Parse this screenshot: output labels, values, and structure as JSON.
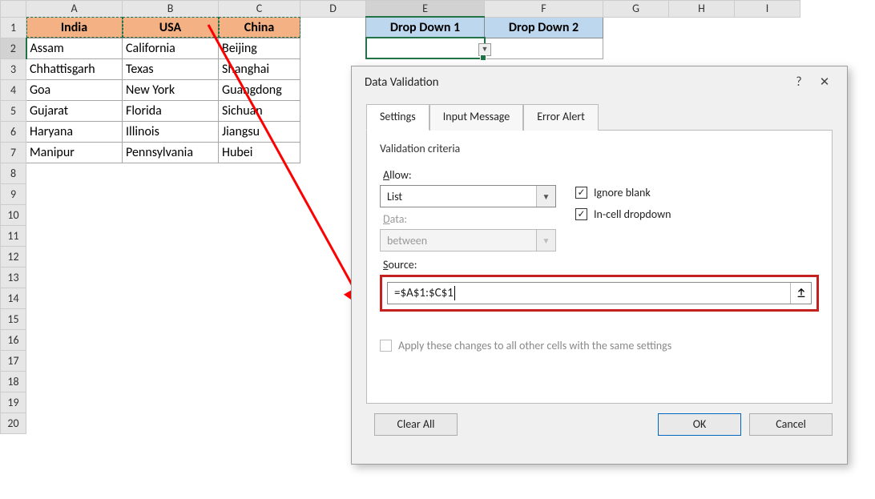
{
  "columns": [
    "A",
    "B",
    "C",
    "D",
    "E",
    "F",
    "G",
    "H",
    "I"
  ],
  "rows": [
    "1",
    "2",
    "3",
    "4",
    "5",
    "6",
    "7",
    "8",
    "9",
    "10",
    "11",
    "12",
    "13",
    "14",
    "15",
    "16",
    "17",
    "18",
    "19",
    "20"
  ],
  "sheet": {
    "headers": [
      "India",
      "USA",
      "China"
    ],
    "dropdown_headers": [
      "Drop Down 1",
      "Drop Down 2"
    ],
    "data": [
      [
        "Assam",
        "California",
        "Beijing"
      ],
      [
        "Chhattisgarh",
        "Texas",
        "Shanghai"
      ],
      [
        "Goa",
        "New York",
        "Guangdong"
      ],
      [
        "Gujarat",
        "Florida",
        "Sichuan"
      ],
      [
        "Haryana",
        "Illinois",
        "Jiangsu"
      ],
      [
        "Manipur",
        "Pennsylvania",
        "Hubei"
      ]
    ]
  },
  "dialog": {
    "title": "Data Validation",
    "tabs": [
      "Settings",
      "Input Message",
      "Error Alert"
    ],
    "criteria_label": "Validation criteria",
    "allow_label": "Allow:",
    "allow_value": "List",
    "data_label": "Data:",
    "data_value": "between",
    "ignore_blank": "Ignore blank",
    "incell_dropdown": "In-cell dropdown",
    "source_label": "Source:",
    "source_value": "=$A$1:$C$1",
    "apply_label": "Apply these changes to all other cells with the same settings",
    "clear_all": "Clear All",
    "ok": "OK",
    "cancel": "Cancel"
  }
}
